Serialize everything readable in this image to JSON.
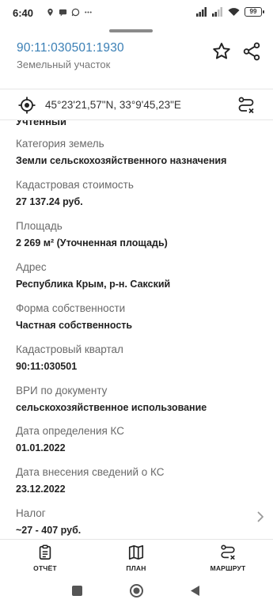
{
  "status_bar": {
    "time": "6:40",
    "battery": "99",
    "left_icons": [
      "location-icon",
      "chat-icon",
      "whatsapp-icon",
      "more-icon"
    ],
    "right_icons": [
      "signal-icon",
      "signal-icon-2",
      "wifi-icon",
      "battery-icon"
    ]
  },
  "header": {
    "cadastral_number": "90:11:030501:1930",
    "subtitle": "Земельный участок",
    "icons": [
      "star-icon",
      "share-icon"
    ]
  },
  "coords_bar": {
    "coordinates": "45°23'21,57\"N, 33°9'45,23\"E",
    "icons": [
      "locate-icon",
      "route-icon"
    ]
  },
  "details": {
    "clipped_value": "Учтенный",
    "fields": [
      {
        "label": "Категория земель",
        "value": "Земли сельскохозяйственного назначения"
      },
      {
        "label": "Кадастровая стоимость",
        "value": "27 137.24 руб."
      },
      {
        "label": "Площадь",
        "value": "2 269 м² (Уточненная площадь)"
      },
      {
        "label": "Адрес",
        "value": "Республика Крым, р-н. Сакский"
      },
      {
        "label": "Форма собственности",
        "value": "Частная собственность"
      },
      {
        "label": "Кадастровый квартал",
        "value": "90:11:030501"
      },
      {
        "label": "ВРИ по документу",
        "value": "сельскохозяйственное использование"
      },
      {
        "label": "Дата определения КС",
        "value": "01.01.2022"
      },
      {
        "label": "Дата внесения сведений о КС",
        "value": "23.12.2022"
      },
      {
        "label": "Налог",
        "value": "~27 - 407 руб."
      }
    ]
  },
  "bottom_nav": {
    "report_label": "ОТЧЁТ",
    "plan_label": "ПЛАН",
    "route_label": "МАРШРУТ"
  },
  "colors": {
    "cadastral_number": "#3a7fb5",
    "label": "#6a6a6a",
    "value": "#222222",
    "divider": "#e6e6e6"
  }
}
